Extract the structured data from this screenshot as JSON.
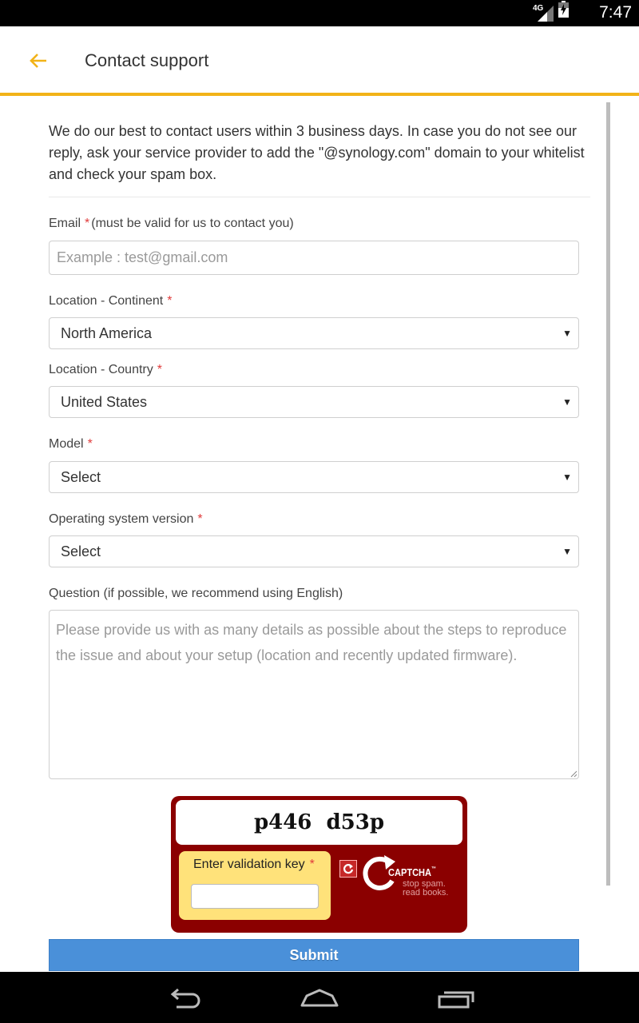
{
  "status_bar": {
    "network": "4G",
    "time": "7:47"
  },
  "header": {
    "title": "Contact support",
    "accent_color": "#f2b318"
  },
  "intro": {
    "text": "We do our best to contact users within 3 business days. In case you do not see our reply, ask your service provider to add the \"@synology.com\" domain to your whitelist and check your spam box."
  },
  "form": {
    "email": {
      "label": "Email",
      "required_mark": "*",
      "note": "(must be valid for us to contact you)",
      "placeholder": "Example : test@gmail.com"
    },
    "continent": {
      "label": "Location - Continent",
      "required_mark": "*",
      "value": "North America"
    },
    "country": {
      "label": "Location - Country",
      "required_mark": "*",
      "value": "United States"
    },
    "model": {
      "label": "Model",
      "required_mark": "*",
      "value": "Select"
    },
    "os_version": {
      "label": "Operating system version",
      "required_mark": "*",
      "value": "Select"
    },
    "question": {
      "label": "Question (if possible, we recommend using English)",
      "placeholder": "Please provide us with as many details as possible about the steps to reproduce the issue and about your setup (location and recently updated firmware)."
    }
  },
  "captcha": {
    "challenge_text": "p446  d53p",
    "entry_label": "Enter validation key",
    "required_mark": "*",
    "brand": "CAPTCHA",
    "trademark": "™",
    "tagline_1": "stop spam.",
    "tagline_2": "read books.",
    "background_color": "#8b0000",
    "entry_color": "#ffe27a"
  },
  "submit": {
    "label": "Submit",
    "color": "#4a90d9"
  },
  "nav_bar": {
    "icons": [
      "back-icon",
      "home-icon",
      "recents-icon"
    ]
  }
}
